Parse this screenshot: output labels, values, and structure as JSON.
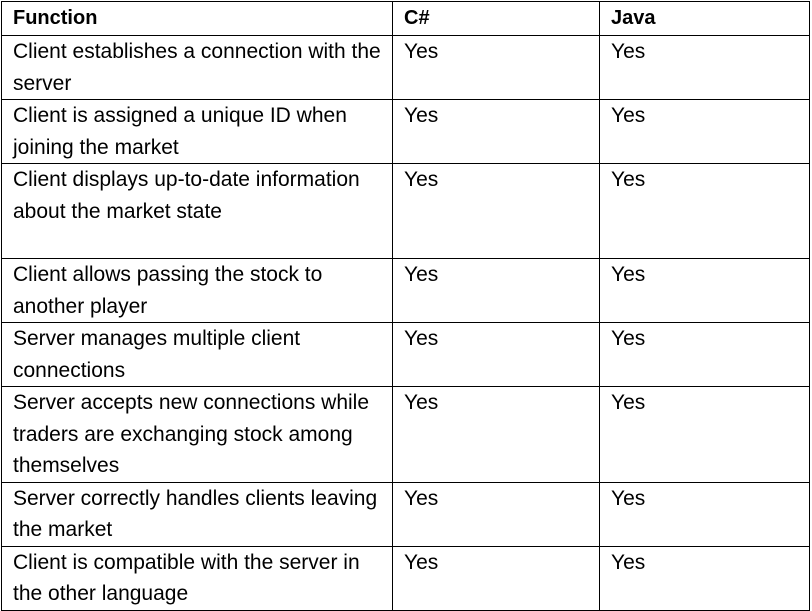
{
  "table": {
    "headers": [
      "Function",
      "C#",
      "Java"
    ],
    "rows": [
      {
        "function": "Client establishes a connection with the server",
        "csharp": "Yes",
        "java": "Yes"
      },
      {
        "function": "Client is assigned a unique ID when joining the market",
        "csharp": "Yes",
        "java": "Yes"
      },
      {
        "function": "Client displays up-to-date information about the market state",
        "csharp": "Yes",
        "java": "Yes"
      },
      {
        "function": "Client allows passing the stock to another player",
        "csharp": "Yes",
        "java": "Yes"
      },
      {
        "function": "Server manages multiple client connections",
        "csharp": "Yes",
        "java": "Yes"
      },
      {
        "function": "Server accepts new connections while traders are exchanging stock among themselves",
        "csharp": "Yes",
        "java": "Yes"
      },
      {
        "function": "Server correctly handles clients leaving the market",
        "csharp": "Yes",
        "java": "Yes"
      },
      {
        "function": "Client is compatible with the server in the other language",
        "csharp": "Yes",
        "java": "Yes"
      }
    ]
  }
}
